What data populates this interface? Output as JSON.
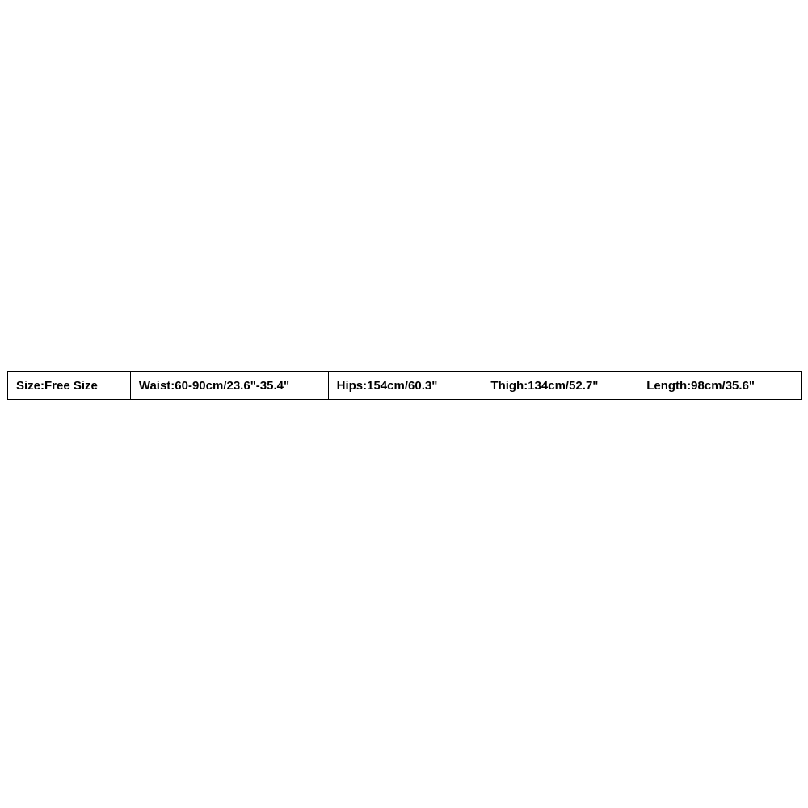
{
  "size_chart": {
    "cells": [
      "Size:Free Size",
      "Waist:60-90cm/23.6\"-35.4\"",
      "Hips:154cm/60.3\"",
      "Thigh:134cm/52.7\"",
      "Length:98cm/35.6\""
    ]
  }
}
